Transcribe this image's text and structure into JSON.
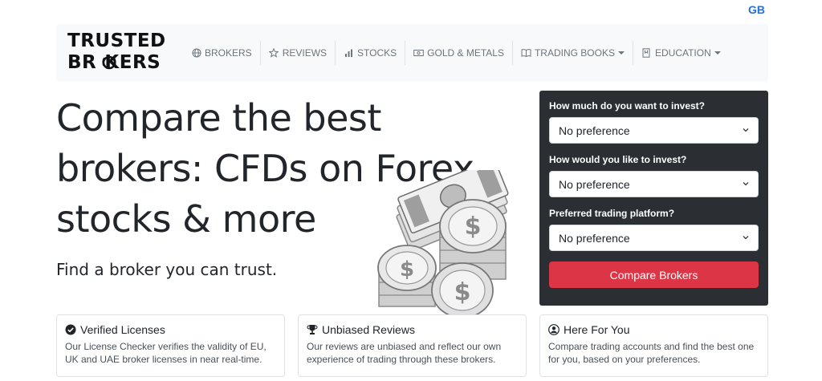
{
  "locale": "GB",
  "logo": {
    "line1": "TRUSTED",
    "line2": "BR  KERS"
  },
  "nav": {
    "items": [
      {
        "label": "BROKERS",
        "icon": "globe-icon",
        "dropdown": false
      },
      {
        "label": "REVIEWS",
        "icon": "star-icon",
        "dropdown": false
      },
      {
        "label": "STOCKS",
        "icon": "bar-chart-icon",
        "dropdown": false
      },
      {
        "label": "GOLD & METALS",
        "icon": "banknote-icon",
        "dropdown": false
      },
      {
        "label": "TRADING BOOKS",
        "icon": "book-icon",
        "dropdown": true
      },
      {
        "label": "EDUCATION",
        "icon": "bookmark-icon",
        "dropdown": true
      }
    ]
  },
  "hero": {
    "title_lines": [
      "Compare the best",
      "brokers: CFDs on Forex,",
      "stocks & more"
    ],
    "subtitle": "Find a broker you can trust."
  },
  "finder": {
    "q1_label": "How much do you want to invest?",
    "q1_value": "No preference",
    "q2_label": "How would you like to invest?",
    "q2_value": "No preference",
    "q3_label": "Preferred trading platform?",
    "q3_value": "No preference",
    "submit_label": "Compare Brokers",
    "button_color": "#dc3545",
    "panel_color": "#2b2f33"
  },
  "features": [
    {
      "icon": "check-circle-icon",
      "title": "Verified Licenses",
      "body": "Our License Checker verifies the validity of EU, UK and UAE broker licenses in near real-time."
    },
    {
      "icon": "trophy-icon",
      "title": "Unbiased Reviews",
      "body": "Our reviews are unbiased and reflect our own experience of trading through these brokers."
    },
    {
      "icon": "person-circle-icon",
      "title": "Here For You",
      "body": "Compare trading accounts and find the best one for you, based on your preferences."
    }
  ],
  "colors": {
    "accent": "#2a6fd6",
    "text": "#22252a"
  }
}
